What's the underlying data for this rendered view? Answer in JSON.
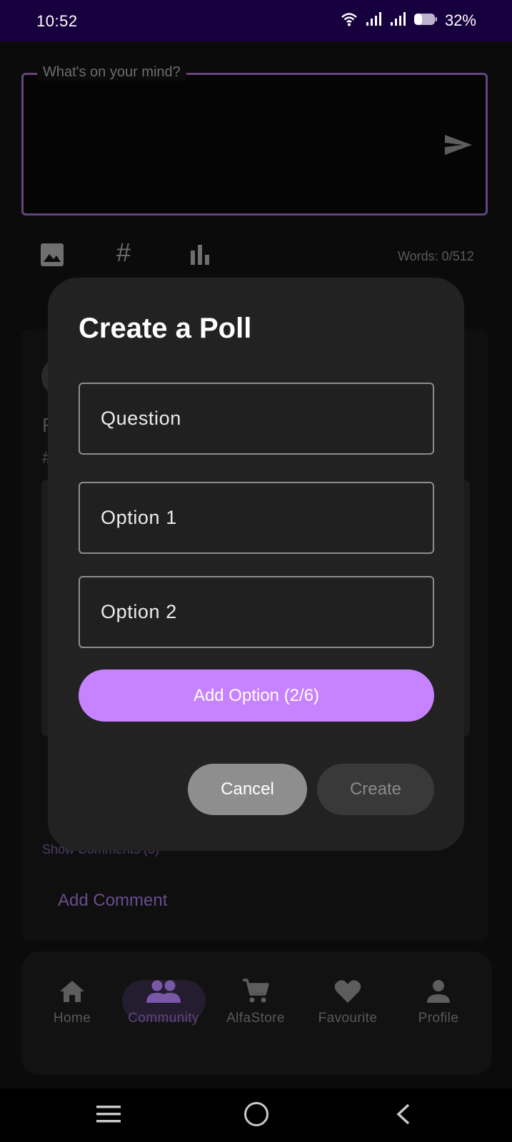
{
  "status_bar": {
    "time": "10:52",
    "battery_percent": "32%",
    "icons": [
      "wifi-icon",
      "signal-icon",
      "signal-icon",
      "battery-icon"
    ]
  },
  "composer": {
    "placeholder_label": "What's on your mind?",
    "word_count": "Words: 0/512",
    "toolbar_icons": [
      "image-icon",
      "hashtag-icon",
      "poll-icon"
    ],
    "send_icon": "send-icon"
  },
  "feed": {
    "post_line_1": "F",
    "post_line_2": "#",
    "show_comments": "Show Comments (0)",
    "add_comment": "Add Comment"
  },
  "dialog": {
    "title": "Create a Poll",
    "question_placeholder": "Question",
    "option1_placeholder": "Option 1",
    "option2_placeholder": "Option 2",
    "add_option_label": "Add Option (2/6)",
    "cancel_label": "Cancel",
    "create_label": "Create"
  },
  "bottom_nav": {
    "items": [
      {
        "label": "Home",
        "icon": "home-icon"
      },
      {
        "label": "Community",
        "icon": "community-icon",
        "active": true
      },
      {
        "label": "AlfaStore",
        "icon": "cart-icon"
      },
      {
        "label": "Favourite",
        "icon": "heart-icon"
      },
      {
        "label": "Profile",
        "icon": "person-icon"
      }
    ]
  },
  "colors": {
    "accent": "#c782ff",
    "status_bar": "#16003e",
    "dialog_bg": "#222222"
  }
}
